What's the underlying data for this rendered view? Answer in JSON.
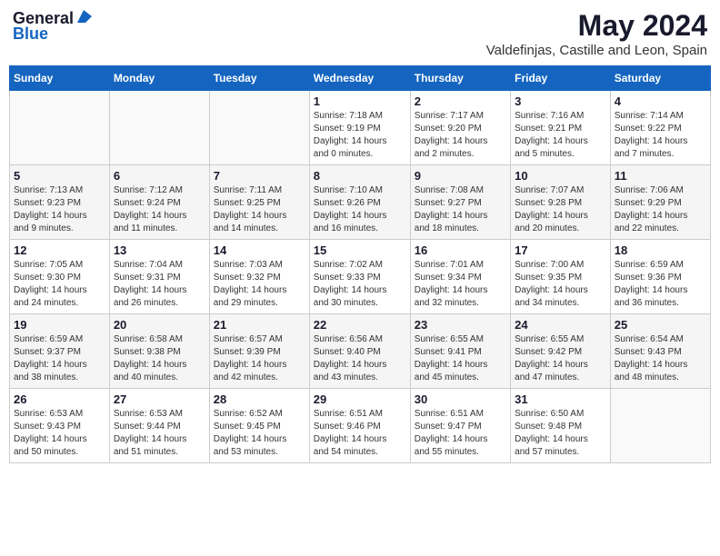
{
  "header": {
    "logo_general": "General",
    "logo_blue": "Blue",
    "month_title": "May 2024",
    "location": "Valdefinjas, Castille and Leon, Spain"
  },
  "days_of_week": [
    "Sunday",
    "Monday",
    "Tuesday",
    "Wednesday",
    "Thursday",
    "Friday",
    "Saturday"
  ],
  "weeks": [
    [
      {
        "day": "",
        "info": ""
      },
      {
        "day": "",
        "info": ""
      },
      {
        "day": "",
        "info": ""
      },
      {
        "day": "1",
        "info": "Sunrise: 7:18 AM\nSunset: 9:19 PM\nDaylight: 14 hours\nand 0 minutes."
      },
      {
        "day": "2",
        "info": "Sunrise: 7:17 AM\nSunset: 9:20 PM\nDaylight: 14 hours\nand 2 minutes."
      },
      {
        "day": "3",
        "info": "Sunrise: 7:16 AM\nSunset: 9:21 PM\nDaylight: 14 hours\nand 5 minutes."
      },
      {
        "day": "4",
        "info": "Sunrise: 7:14 AM\nSunset: 9:22 PM\nDaylight: 14 hours\nand 7 minutes."
      }
    ],
    [
      {
        "day": "5",
        "info": "Sunrise: 7:13 AM\nSunset: 9:23 PM\nDaylight: 14 hours\nand 9 minutes."
      },
      {
        "day": "6",
        "info": "Sunrise: 7:12 AM\nSunset: 9:24 PM\nDaylight: 14 hours\nand 11 minutes."
      },
      {
        "day": "7",
        "info": "Sunrise: 7:11 AM\nSunset: 9:25 PM\nDaylight: 14 hours\nand 14 minutes."
      },
      {
        "day": "8",
        "info": "Sunrise: 7:10 AM\nSunset: 9:26 PM\nDaylight: 14 hours\nand 16 minutes."
      },
      {
        "day": "9",
        "info": "Sunrise: 7:08 AM\nSunset: 9:27 PM\nDaylight: 14 hours\nand 18 minutes."
      },
      {
        "day": "10",
        "info": "Sunrise: 7:07 AM\nSunset: 9:28 PM\nDaylight: 14 hours\nand 20 minutes."
      },
      {
        "day": "11",
        "info": "Sunrise: 7:06 AM\nSunset: 9:29 PM\nDaylight: 14 hours\nand 22 minutes."
      }
    ],
    [
      {
        "day": "12",
        "info": "Sunrise: 7:05 AM\nSunset: 9:30 PM\nDaylight: 14 hours\nand 24 minutes."
      },
      {
        "day": "13",
        "info": "Sunrise: 7:04 AM\nSunset: 9:31 PM\nDaylight: 14 hours\nand 26 minutes."
      },
      {
        "day": "14",
        "info": "Sunrise: 7:03 AM\nSunset: 9:32 PM\nDaylight: 14 hours\nand 29 minutes."
      },
      {
        "day": "15",
        "info": "Sunrise: 7:02 AM\nSunset: 9:33 PM\nDaylight: 14 hours\nand 30 minutes."
      },
      {
        "day": "16",
        "info": "Sunrise: 7:01 AM\nSunset: 9:34 PM\nDaylight: 14 hours\nand 32 minutes."
      },
      {
        "day": "17",
        "info": "Sunrise: 7:00 AM\nSunset: 9:35 PM\nDaylight: 14 hours\nand 34 minutes."
      },
      {
        "day": "18",
        "info": "Sunrise: 6:59 AM\nSunset: 9:36 PM\nDaylight: 14 hours\nand 36 minutes."
      }
    ],
    [
      {
        "day": "19",
        "info": "Sunrise: 6:59 AM\nSunset: 9:37 PM\nDaylight: 14 hours\nand 38 minutes."
      },
      {
        "day": "20",
        "info": "Sunrise: 6:58 AM\nSunset: 9:38 PM\nDaylight: 14 hours\nand 40 minutes."
      },
      {
        "day": "21",
        "info": "Sunrise: 6:57 AM\nSunset: 9:39 PM\nDaylight: 14 hours\nand 42 minutes."
      },
      {
        "day": "22",
        "info": "Sunrise: 6:56 AM\nSunset: 9:40 PM\nDaylight: 14 hours\nand 43 minutes."
      },
      {
        "day": "23",
        "info": "Sunrise: 6:55 AM\nSunset: 9:41 PM\nDaylight: 14 hours\nand 45 minutes."
      },
      {
        "day": "24",
        "info": "Sunrise: 6:55 AM\nSunset: 9:42 PM\nDaylight: 14 hours\nand 47 minutes."
      },
      {
        "day": "25",
        "info": "Sunrise: 6:54 AM\nSunset: 9:43 PM\nDaylight: 14 hours\nand 48 minutes."
      }
    ],
    [
      {
        "day": "26",
        "info": "Sunrise: 6:53 AM\nSunset: 9:43 PM\nDaylight: 14 hours\nand 50 minutes."
      },
      {
        "day": "27",
        "info": "Sunrise: 6:53 AM\nSunset: 9:44 PM\nDaylight: 14 hours\nand 51 minutes."
      },
      {
        "day": "28",
        "info": "Sunrise: 6:52 AM\nSunset: 9:45 PM\nDaylight: 14 hours\nand 53 minutes."
      },
      {
        "day": "29",
        "info": "Sunrise: 6:51 AM\nSunset: 9:46 PM\nDaylight: 14 hours\nand 54 minutes."
      },
      {
        "day": "30",
        "info": "Sunrise: 6:51 AM\nSunset: 9:47 PM\nDaylight: 14 hours\nand 55 minutes."
      },
      {
        "day": "31",
        "info": "Sunrise: 6:50 AM\nSunset: 9:48 PM\nDaylight: 14 hours\nand 57 minutes."
      },
      {
        "day": "",
        "info": ""
      }
    ]
  ]
}
